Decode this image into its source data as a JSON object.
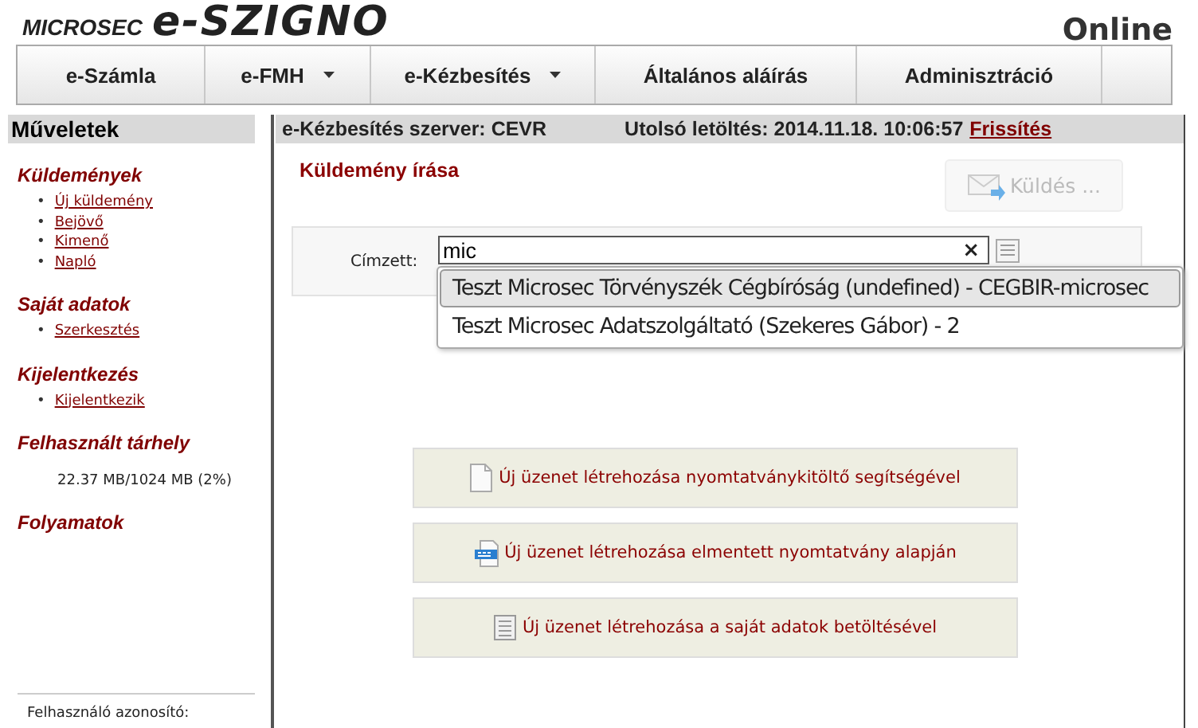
{
  "header": {
    "logo_small": "MICROSEC",
    "logo_large": "e-SZIGNO",
    "status": "Online"
  },
  "nav": [
    {
      "label": "e-Számla",
      "has_menu": false
    },
    {
      "label": "e-FMH",
      "has_menu": true
    },
    {
      "label": "e-Kézbesítés",
      "has_menu": true
    },
    {
      "label": "Általános aláírás",
      "has_menu": false
    },
    {
      "label": "Adminisztráció",
      "has_menu": false
    }
  ],
  "sidebar": {
    "title": "Műveletek",
    "sections": [
      {
        "title": "Küldemények",
        "items": [
          {
            "kind": "link",
            "marker": "•",
            "text": "Új küldemény"
          },
          {
            "kind": "link",
            "marker": "•",
            "text": "Bejövő"
          },
          {
            "kind": "link",
            "marker": "•",
            "text": "Kimenő"
          },
          {
            "kind": "link",
            "marker": "•",
            "text": "Napló"
          }
        ]
      },
      {
        "title": "Saját adatok",
        "items": [
          {
            "kind": "link",
            "marker": "•",
            "text": "Szerkesztés"
          }
        ]
      },
      {
        "title": "Kijelentkezés",
        "items": [
          {
            "kind": "link",
            "marker": "•",
            "text": "Kijelentkezik"
          }
        ]
      },
      {
        "title": "Felhasznált tárhely",
        "items": [
          {
            "kind": "text",
            "text": "22.37 MB/1024 MB (2%)"
          }
        ]
      },
      {
        "title": "Folyamatok"
      }
    ],
    "footer": "Felhasználó azonosító:"
  },
  "main": {
    "server": "e-Kézbesítés szerver: CEVR",
    "last_download": "Utolsó letöltés: 2014.11.18. 10:06:57",
    "refresh": "Frissítés",
    "title": "Küldemény írása",
    "send_button": {
      "label": "Küldés ...",
      "disabled": true
    },
    "recipient": {
      "label": "Címzett:",
      "value": "mic",
      "clear": "×"
    },
    "suggestions": [
      {
        "text": "Teszt Microsec Törvényszék Cégbíróság (undefined) - CEGBIR-microsec",
        "selected": true
      },
      {
        "text": "Teszt Microsec Adatszolgáltató (Szekeres Gábor) - 2",
        "selected": false
      }
    ],
    "actions": [
      {
        "kind": "form",
        "label": "Új üzenet létrehozása nyomtatványkitöltő segítségével"
      },
      {
        "kind": "saved",
        "label": "Új üzenet létrehozása elmentett nyomtatvány alapján"
      },
      {
        "kind": "own",
        "label": "Új üzenet létrehozása a saját adatok betöltésével"
      }
    ]
  }
}
